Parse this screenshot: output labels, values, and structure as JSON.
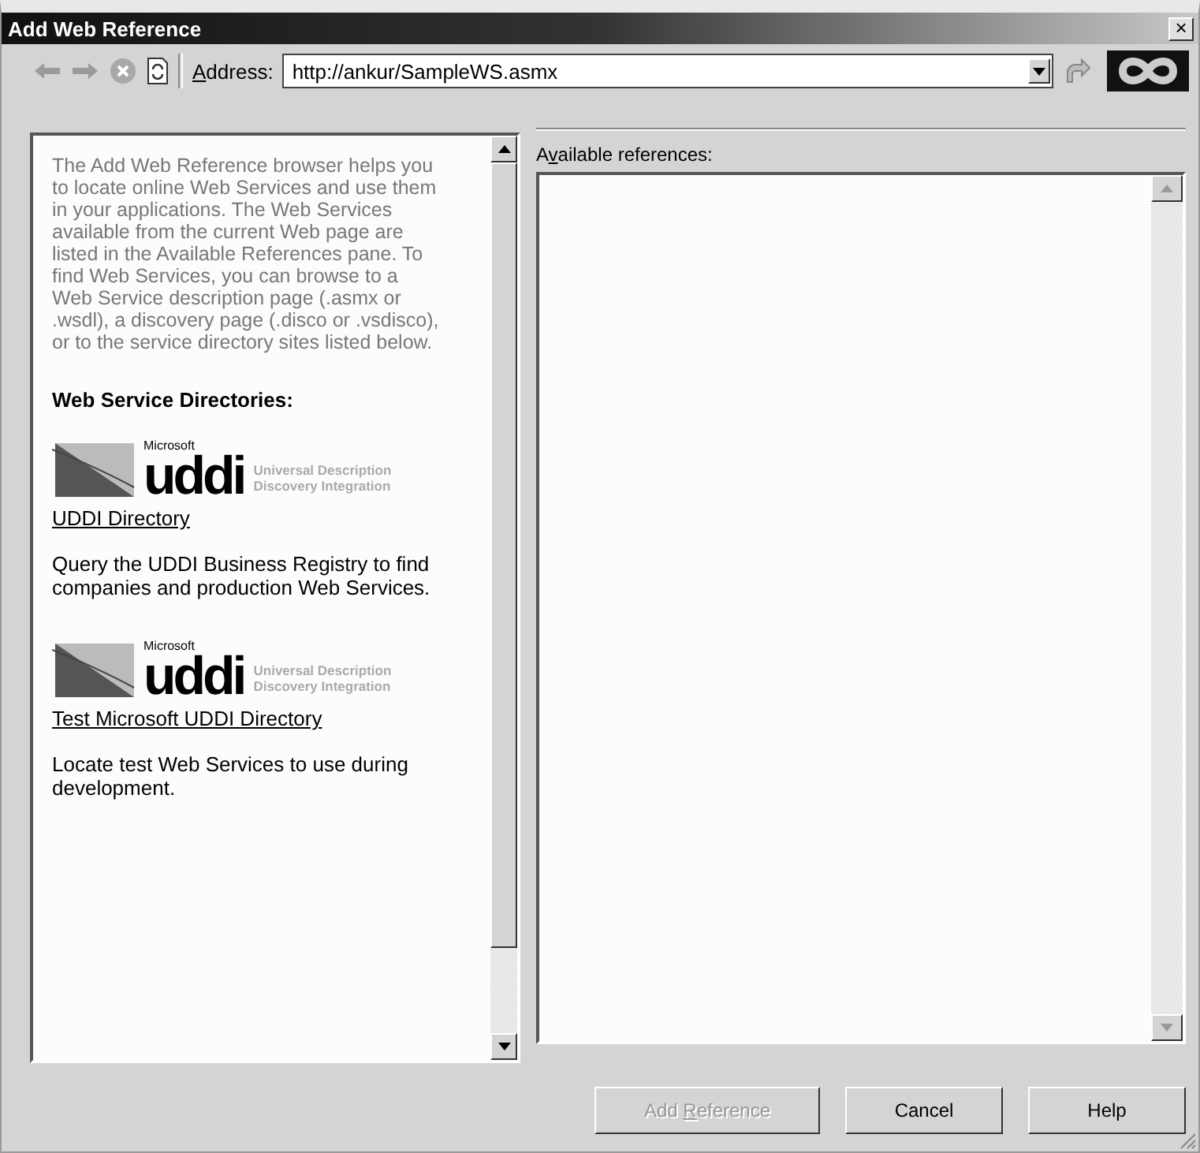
{
  "window": {
    "title": "Add Web Reference",
    "close": "×"
  },
  "toolbar": {
    "address_label": [
      {
        "text": "A",
        "access_key": true
      },
      {
        "text": "ddress:",
        "access_key": false
      }
    ],
    "address_value": "http://ankur/SampleWS.asmx"
  },
  "browser": {
    "intro": "The Add Web Reference browser helps you to locate online Web Services and use them in your applications. The Web Services available from the current Web page are listed in the Available References pane. To find Web Services, you can browse to a Web Service description page (.asmx or .wsdl), a discovery page (.disco or .vsdisco), or to the service directory sites listed below.",
    "heading": "Web Service Directories:",
    "directories": [
      {
        "logo": {
          "brand": "Microsoft",
          "mark": "uddi",
          "line_1": "Universal Description",
          "line_2": "Discovery Integration"
        },
        "link": "UDDI Directory",
        "description": "Query the UDDI Business Registry to find companies and production Web Services."
      },
      {
        "logo": {
          "brand": "Microsoft",
          "mark": "uddi",
          "line_1": "Universal Description",
          "line_2": "Discovery Integration"
        },
        "link": "Test Microsoft UDDI Directory",
        "description": "Locate test Web Services to use during development."
      }
    ]
  },
  "references": {
    "label": [
      {
        "text": "A",
        "access_key": false
      },
      {
        "text": "v",
        "access_key": true
      },
      {
        "text": "ailable references:",
        "access_key": false
      }
    ]
  },
  "buttons": [
    {
      "label": [
        {
          "text": "Add ",
          "access_key": false
        },
        {
          "text": "R",
          "access_key": true
        },
        {
          "text": "eference",
          "access_key": false
        }
      ],
      "disabled": true
    },
    {
      "label": [
        {
          "text": "Cancel",
          "access_key": false
        }
      ],
      "disabled": false
    },
    {
      "label": [
        {
          "text": "Help",
          "access_key": false
        }
      ],
      "disabled": false
    }
  ]
}
